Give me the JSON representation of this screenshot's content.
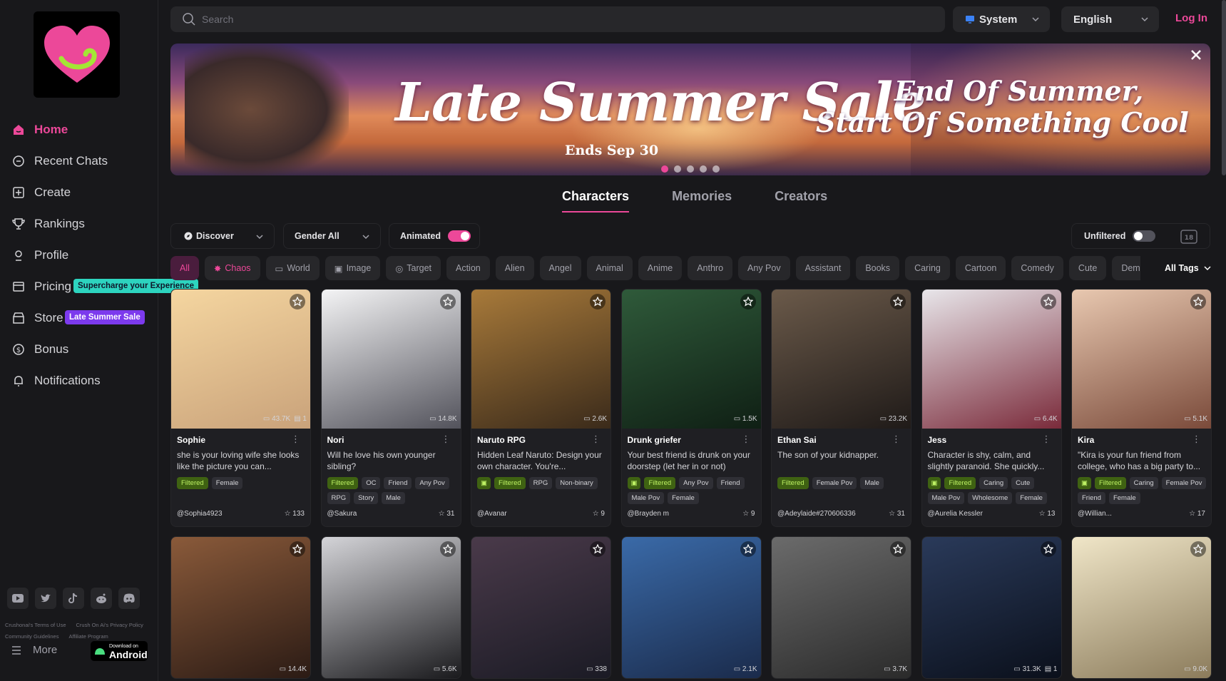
{
  "sidebar": {
    "nav": [
      {
        "label": "Home",
        "icon": "home-icon",
        "active": true
      },
      {
        "label": "Recent Chats",
        "icon": "chat-icon"
      },
      {
        "label": "Create",
        "icon": "plus-square-icon"
      },
      {
        "label": "Rankings",
        "icon": "trophy-icon"
      },
      {
        "label": "Profile",
        "icon": "user-icon"
      },
      {
        "label": "Pricing",
        "icon": "card-icon",
        "badge": "Supercharge your Experience"
      },
      {
        "label": "Store",
        "icon": "store-icon",
        "badge": "Late Summer Sale"
      },
      {
        "label": "Bonus",
        "icon": "coin-icon"
      },
      {
        "label": "Notifications",
        "icon": "bell-icon"
      }
    ],
    "legal": [
      "Crushonai's Terms of Use",
      "Crush On Ai's Privacy Policy",
      "Community Guidelines",
      "Affiliate Program"
    ],
    "more_label": "More",
    "android": {
      "small": "Download on",
      "big": "Android"
    }
  },
  "header": {
    "search_placeholder": "Search",
    "theme": "System",
    "language": "English",
    "login": "Log In"
  },
  "banner": {
    "title": "Late Summer Sale",
    "ends": "Ends Sep 30",
    "subtitle_1": "End Of Summer,",
    "subtitle_2": "Start Of Something Cool",
    "slide_count": 5,
    "active_slide": 1
  },
  "tabs": [
    "Characters",
    "Memories",
    "Creators"
  ],
  "filters": {
    "discover": "Discover",
    "gender": "Gender All",
    "animated": "Animated",
    "animated_on": true,
    "unfiltered": "Unfiltered",
    "unfiltered_on": false
  },
  "tags": [
    "All",
    "Chaos",
    "World",
    "Image",
    "Target",
    "Action",
    "Alien",
    "Angel",
    "Animal",
    "Anime",
    "Anthro",
    "Any Pov",
    "Assistant",
    "Books",
    "Caring",
    "Cartoon",
    "Comedy",
    "Cute",
    "Demon",
    "De"
  ],
  "all_tags_label": "All Tags",
  "cards": [
    {
      "name": "Sophie",
      "desc": "she is your loving wife she looks like the picture you can...",
      "chats": "43.7K",
      "memories": "1",
      "tags": [
        "Filtered",
        "Female"
      ],
      "author": "@Sophia4923",
      "likes": "133",
      "colors": [
        "#f5d6a0",
        "#c9a27a"
      ]
    },
    {
      "name": "Nori",
      "desc": "Will he love his own younger sibling?",
      "chats": "14.8K",
      "tags": [
        "Filtered",
        "OC",
        "Friend",
        "Any Pov",
        "RPG",
        "Story",
        "Male"
      ],
      "author": "@Sakura",
      "likes": "31",
      "colors": [
        "#f4f4f5",
        "#52525b"
      ]
    },
    {
      "name": "Naruto RPG",
      "desc": "Hidden Leaf Naruto: Design your own character. You're...",
      "chats": "2.6K",
      "tags": [
        "@",
        "Filtered",
        "RPG",
        "Non-binary"
      ],
      "author": "@Avanar",
      "likes": "9",
      "colors": [
        "#a87a3a",
        "#3a2a1a"
      ]
    },
    {
      "name": "Drunk griefer",
      "desc": "Your best friend is drunk on your doorstep (let her in or not)",
      "chats": "1.5K",
      "tags": [
        "@",
        "Filtered",
        "Any Pov",
        "Friend",
        "Male Pov",
        "Female"
      ],
      "author": "@Brayden m",
      "likes": "9",
      "colors": [
        "#2f5a3a",
        "#0f1f14"
      ]
    },
    {
      "name": "Ethan Sai",
      "desc": "The son of your kidnapper.",
      "chats": "23.2K",
      "tags": [
        "Filtered",
        "Female Pov",
        "Male"
      ],
      "author": "@Adeylaide#270606336",
      "likes": "31",
      "colors": [
        "#6b5a4a",
        "#1f1a18"
      ]
    },
    {
      "name": "Jess",
      "desc": "Character is shy, calm, and slightly paranoid. She quickly...",
      "chats": "6.4K",
      "tags": [
        "@",
        "Filtered",
        "Caring",
        "Cute",
        "Male Pov",
        "Wholesome",
        "Female"
      ],
      "author": "@Aurelia Kessler",
      "likes": "13",
      "colors": [
        "#e8e6ea",
        "#7a2a3a"
      ]
    },
    {
      "name": "Kira",
      "desc": "\"Kira is your fun friend from college, who has a big party to...",
      "chats": "5.1K",
      "tags": [
        "@",
        "Filtered",
        "Caring",
        "Female Pov",
        "Friend",
        "Female"
      ],
      "author": "@Willian...",
      "likes": "17",
      "colors": [
        "#e8c8b0",
        "#7a4a3a"
      ]
    }
  ],
  "cards_row2": [
    {
      "chats": "14.4K",
      "colors": [
        "#8a5a3a",
        "#2a1a14"
      ]
    },
    {
      "chats": "5.6K",
      "colors": [
        "#d4d4d8",
        "#18181b"
      ]
    },
    {
      "chats": "338",
      "colors": [
        "#4a3a4a",
        "#1a1a24"
      ]
    },
    {
      "chats": "2.1K",
      "colors": [
        "#3a6aa8",
        "#1a2a4a"
      ]
    },
    {
      "chats": "3.7K",
      "colors": [
        "#6b6b6b",
        "#2a2a2a"
      ]
    },
    {
      "chats": "31.3K",
      "memories": "1",
      "colors": [
        "#2a3a5a",
        "#0a0f1a"
      ]
    },
    {
      "chats": "9.0K",
      "colors": [
        "#f0e6c8",
        "#8a7a5a"
      ]
    }
  ],
  "colors": {
    "accent": "#ec4899",
    "bg": "#18181b",
    "filtered_bg": "#3f6212",
    "filtered_text": "#bef264"
  }
}
